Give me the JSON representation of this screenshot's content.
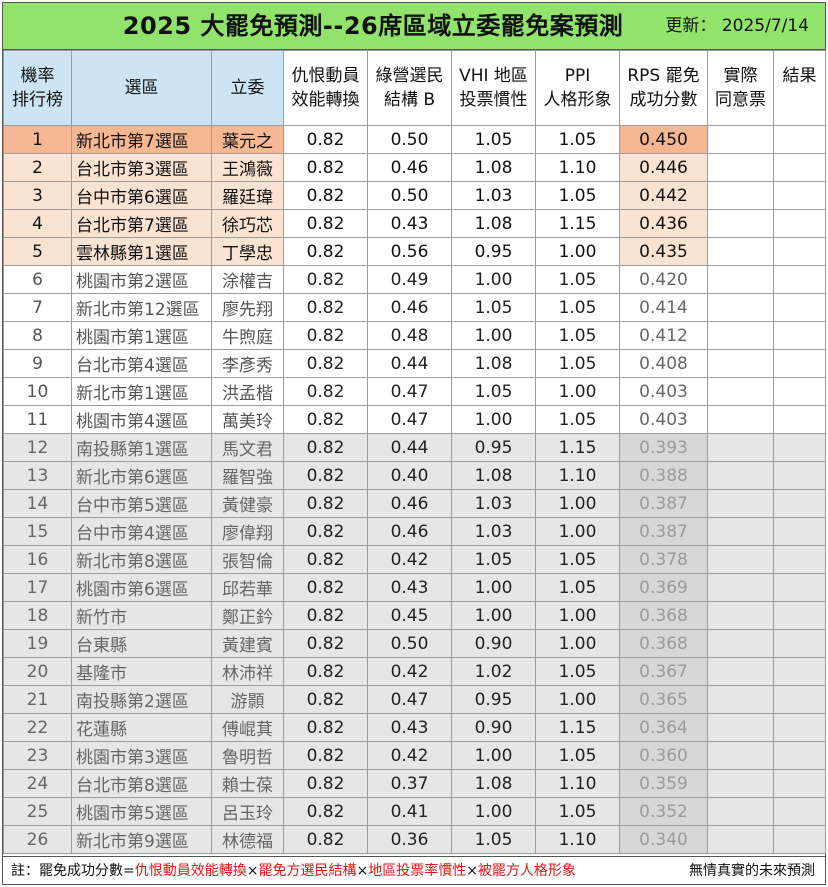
{
  "title": "2025 大罷免預測--26席區域立委罷免案預測",
  "updated_label": "更新：",
  "updated_date": "2025/7/14",
  "headers": {
    "rank_1": "機率",
    "rank_2": "排行榜",
    "district": "選區",
    "legislator": "立委",
    "f1_1": "仇恨動員",
    "f1_2": "效能轉換",
    "f2_1": "綠營選民",
    "f2_2": "結構 B",
    "f3_1": "VHI 地區",
    "f3_2": "投票慣性",
    "f4_1": "PPI",
    "f4_2": "人格形象",
    "rps_1": "RPS 罷免",
    "rps_2": "成功分數",
    "actual_1": "實際",
    "actual_2": "同意票",
    "result": "結果"
  },
  "rows": [
    {
      "rank": "1",
      "district": "新北市第7選區",
      "legislator": "葉元之",
      "f1": "0.82",
      "f2": "0.50",
      "f3": "1.05",
      "f4": "1.05",
      "rps": "0.450"
    },
    {
      "rank": "2",
      "district": "台北市第3選區",
      "legislator": "王鴻薇",
      "f1": "0.82",
      "f2": "0.46",
      "f3": "1.08",
      "f4": "1.10",
      "rps": "0.446"
    },
    {
      "rank": "3",
      "district": "台中市第6選區",
      "legislator": "羅廷瑋",
      "f1": "0.82",
      "f2": "0.50",
      "f3": "1.03",
      "f4": "1.05",
      "rps": "0.442"
    },
    {
      "rank": "4",
      "district": "台北市第7選區",
      "legislator": "徐巧芯",
      "f1": "0.82",
      "f2": "0.43",
      "f3": "1.08",
      "f4": "1.15",
      "rps": "0.436"
    },
    {
      "rank": "5",
      "district": "雲林縣第1選區",
      "legislator": "丁學忠",
      "f1": "0.82",
      "f2": "0.56",
      "f3": "0.95",
      "f4": "1.00",
      "rps": "0.435"
    },
    {
      "rank": "6",
      "district": "桃園市第2選區",
      "legislator": "涂權吉",
      "f1": "0.82",
      "f2": "0.49",
      "f3": "1.00",
      "f4": "1.05",
      "rps": "0.420"
    },
    {
      "rank": "7",
      "district": "新北市第12選區",
      "legislator": "廖先翔",
      "f1": "0.82",
      "f2": "0.46",
      "f3": "1.05",
      "f4": "1.05",
      "rps": "0.414"
    },
    {
      "rank": "8",
      "district": "桃園市第1選區",
      "legislator": "牛煦庭",
      "f1": "0.82",
      "f2": "0.48",
      "f3": "1.00",
      "f4": "1.05",
      "rps": "0.412"
    },
    {
      "rank": "9",
      "district": "台北市第4選區",
      "legislator": "李彥秀",
      "f1": "0.82",
      "f2": "0.44",
      "f3": "1.08",
      "f4": "1.05",
      "rps": "0.408"
    },
    {
      "rank": "10",
      "district": "新北市第1選區",
      "legislator": "洪孟楷",
      "f1": "0.82",
      "f2": "0.47",
      "f3": "1.05",
      "f4": "1.00",
      "rps": "0.403"
    },
    {
      "rank": "11",
      "district": "桃園市第4選區",
      "legislator": "萬美玲",
      "f1": "0.82",
      "f2": "0.47",
      "f3": "1.00",
      "f4": "1.05",
      "rps": "0.403"
    },
    {
      "rank": "12",
      "district": "南投縣第1選區",
      "legislator": "馬文君",
      "f1": "0.82",
      "f2": "0.44",
      "f3": "0.95",
      "f4": "1.15",
      "rps": "0.393"
    },
    {
      "rank": "13",
      "district": "新北市第6選區",
      "legislator": "羅智強",
      "f1": "0.82",
      "f2": "0.40",
      "f3": "1.08",
      "f4": "1.10",
      "rps": "0.388"
    },
    {
      "rank": "14",
      "district": "台中市第5選區",
      "legislator": "黃健豪",
      "f1": "0.82",
      "f2": "0.46",
      "f3": "1.03",
      "f4": "1.00",
      "rps": "0.387"
    },
    {
      "rank": "15",
      "district": "台中市第4選區",
      "legislator": "廖偉翔",
      "f1": "0.82",
      "f2": "0.46",
      "f3": "1.03",
      "f4": "1.00",
      "rps": "0.387"
    },
    {
      "rank": "16",
      "district": "新北市第8選區",
      "legislator": "張智倫",
      "f1": "0.82",
      "f2": "0.42",
      "f3": "1.05",
      "f4": "1.05",
      "rps": "0.378"
    },
    {
      "rank": "17",
      "district": "桃園市第6選區",
      "legislator": "邱若華",
      "f1": "0.82",
      "f2": "0.43",
      "f3": "1.00",
      "f4": "1.05",
      "rps": "0.369"
    },
    {
      "rank": "18",
      "district": "新竹市",
      "legislator": "鄭正鈐",
      "f1": "0.82",
      "f2": "0.45",
      "f3": "1.00",
      "f4": "1.00",
      "rps": "0.368"
    },
    {
      "rank": "19",
      "district": "台東縣",
      "legislator": "黃建賓",
      "f1": "0.82",
      "f2": "0.50",
      "f3": "0.90",
      "f4": "1.00",
      "rps": "0.368"
    },
    {
      "rank": "20",
      "district": "基隆市",
      "legislator": "林沛祥",
      "f1": "0.82",
      "f2": "0.42",
      "f3": "1.02",
      "f4": "1.05",
      "rps": "0.367"
    },
    {
      "rank": "21",
      "district": "南投縣第2選區",
      "legislator": "游顥",
      "f1": "0.82",
      "f2": "0.47",
      "f3": "0.95",
      "f4": "1.00",
      "rps": "0.365"
    },
    {
      "rank": "22",
      "district": "花蓮縣",
      "legislator": "傅崐萁",
      "f1": "0.82",
      "f2": "0.43",
      "f3": "0.90",
      "f4": "1.15",
      "rps": "0.364"
    },
    {
      "rank": "23",
      "district": "桃園市第3選區",
      "legislator": "魯明哲",
      "f1": "0.82",
      "f2": "0.42",
      "f3": "1.00",
      "f4": "1.05",
      "rps": "0.360"
    },
    {
      "rank": "24",
      "district": "台北市第8選區",
      "legislator": "賴士葆",
      "f1": "0.82",
      "f2": "0.37",
      "f3": "1.08",
      "f4": "1.10",
      "rps": "0.359"
    },
    {
      "rank": "25",
      "district": "桃園市第5選區",
      "legislator": "呂玉玲",
      "f1": "0.82",
      "f2": "0.41",
      "f3": "1.00",
      "f4": "1.05",
      "rps": "0.352"
    },
    {
      "rank": "26",
      "district": "新北市第9選區",
      "legislator": "林德福",
      "f1": "0.82",
      "f2": "0.36",
      "f3": "1.05",
      "f4": "1.10",
      "rps": "0.340"
    }
  ],
  "footer": {
    "prefix": "註：罷免成功分數=",
    "term1": "仇恨動員效能轉換",
    "term2": "罷免方選民結構",
    "term3": "地區投票率慣性",
    "term4": "被罷方人格形象",
    "times": "×",
    "right": "無情真實的未來預測"
  },
  "colors": {
    "title_bar": "#92e36c",
    "header_blue": "#cde4f3",
    "highlight_rank1": "#f6b892",
    "highlight_top5": "#fbe3d3",
    "low_tier_gray": "#e6e6e6",
    "footer_red": "#e01515"
  }
}
